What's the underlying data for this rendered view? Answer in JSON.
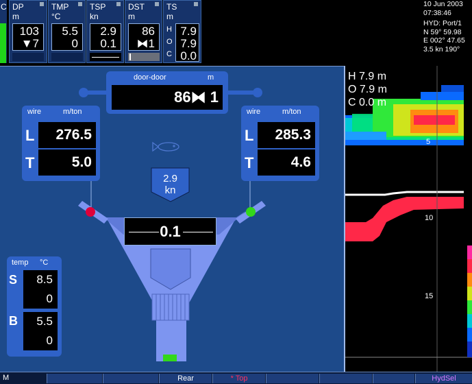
{
  "top_panels": [
    {
      "title": "DP",
      "unit": "m",
      "v1": "103",
      "v2": "▼7"
    },
    {
      "title": "TMP",
      "unit": "°C",
      "v1": "5.5",
      "v2": "0"
    },
    {
      "title": "TSP",
      "unit": "kn",
      "v1": "2.9",
      "v2": "0.1"
    },
    {
      "title": "DST",
      "unit": "m",
      "v1": "86",
      "v2": "⧓1"
    },
    {
      "title": "TS",
      "unit": "m",
      "rows": [
        {
          "k": "H",
          "v": "7.9"
        },
        {
          "k": "O",
          "v": "7.9"
        },
        {
          "k": "C",
          "v": "0.0"
        }
      ]
    }
  ],
  "left_edge_label": "C",
  "info": {
    "date": "10 Jun 2003",
    "time": "07:38:46",
    "source": "HYD: Port/1",
    "lat": "N  59° 59.98",
    "lon": "E 002° 47.65",
    "speed_heading": "3.5 kn  190°"
  },
  "door": {
    "label": "door-door",
    "unit": "m",
    "value": "86⧓ 1"
  },
  "wire_left": {
    "hdr": "wire",
    "unit": "m/ton",
    "L": "276.5",
    "T": "5.0",
    "Llbl": "L",
    "Tlbl": "T"
  },
  "wire_right": {
    "hdr": "wire",
    "unit": "m/ton",
    "L": "285.3",
    "T": "4.6",
    "Llbl": "L",
    "Tlbl": "T"
  },
  "speed": {
    "value": "2.9",
    "unit": "kn"
  },
  "headrope": {
    "value": "0.1"
  },
  "temp": {
    "hdr": "temp",
    "unit": "°C",
    "S": "8.5",
    "S2": "0",
    "B": "5.5",
    "B2": "0",
    "Slbl": "S",
    "Blbl": "B"
  },
  "sonar": {
    "H": "H  7.9 m",
    "O": "O  7.9 m",
    "C": "C  0.0 m",
    "depth_ticks": [
      "5",
      "10",
      "15"
    ]
  },
  "bottom": {
    "left": "M",
    "rear": "Rear",
    "top": "* Top",
    "hydsel": "HydSel"
  },
  "colors": {
    "bg": "#1d4a8a",
    "panel": "#2f62c8",
    "trawl": "#7d95f0",
    "red": "#e0003a",
    "green": "#33d81a"
  }
}
